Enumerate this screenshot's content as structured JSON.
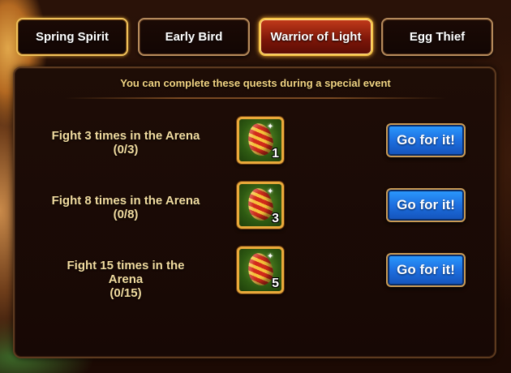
{
  "tabs": [
    {
      "label": "Spring Spirit"
    },
    {
      "label": "Early Bird"
    },
    {
      "label": "Warrior of Light"
    },
    {
      "label": "Egg Thief"
    }
  ],
  "active_tab": "Warrior of Light",
  "subtitle": "You can complete these quests during a special event",
  "quests": [
    {
      "title": "Fight 3 times in the Arena",
      "progress": "(0/3)",
      "reward_count": "1",
      "button": "Go for it!"
    },
    {
      "title": "Fight 8 times in the Arena",
      "progress": "(0/8)",
      "reward_count": "3",
      "button": "Go for it!"
    },
    {
      "title": "Fight 15 times in the Arena",
      "progress": "(0/15)",
      "reward_count": "5",
      "button": "Go for it!"
    }
  ],
  "reward_icon": "easter-egg-icon",
  "colors": {
    "active_tab": "#a8280f",
    "go_button": "#1d6fe0",
    "quest_text": "#f2dca0",
    "subtitle_text": "#f2d483",
    "reward_border": "#e9a93a"
  }
}
